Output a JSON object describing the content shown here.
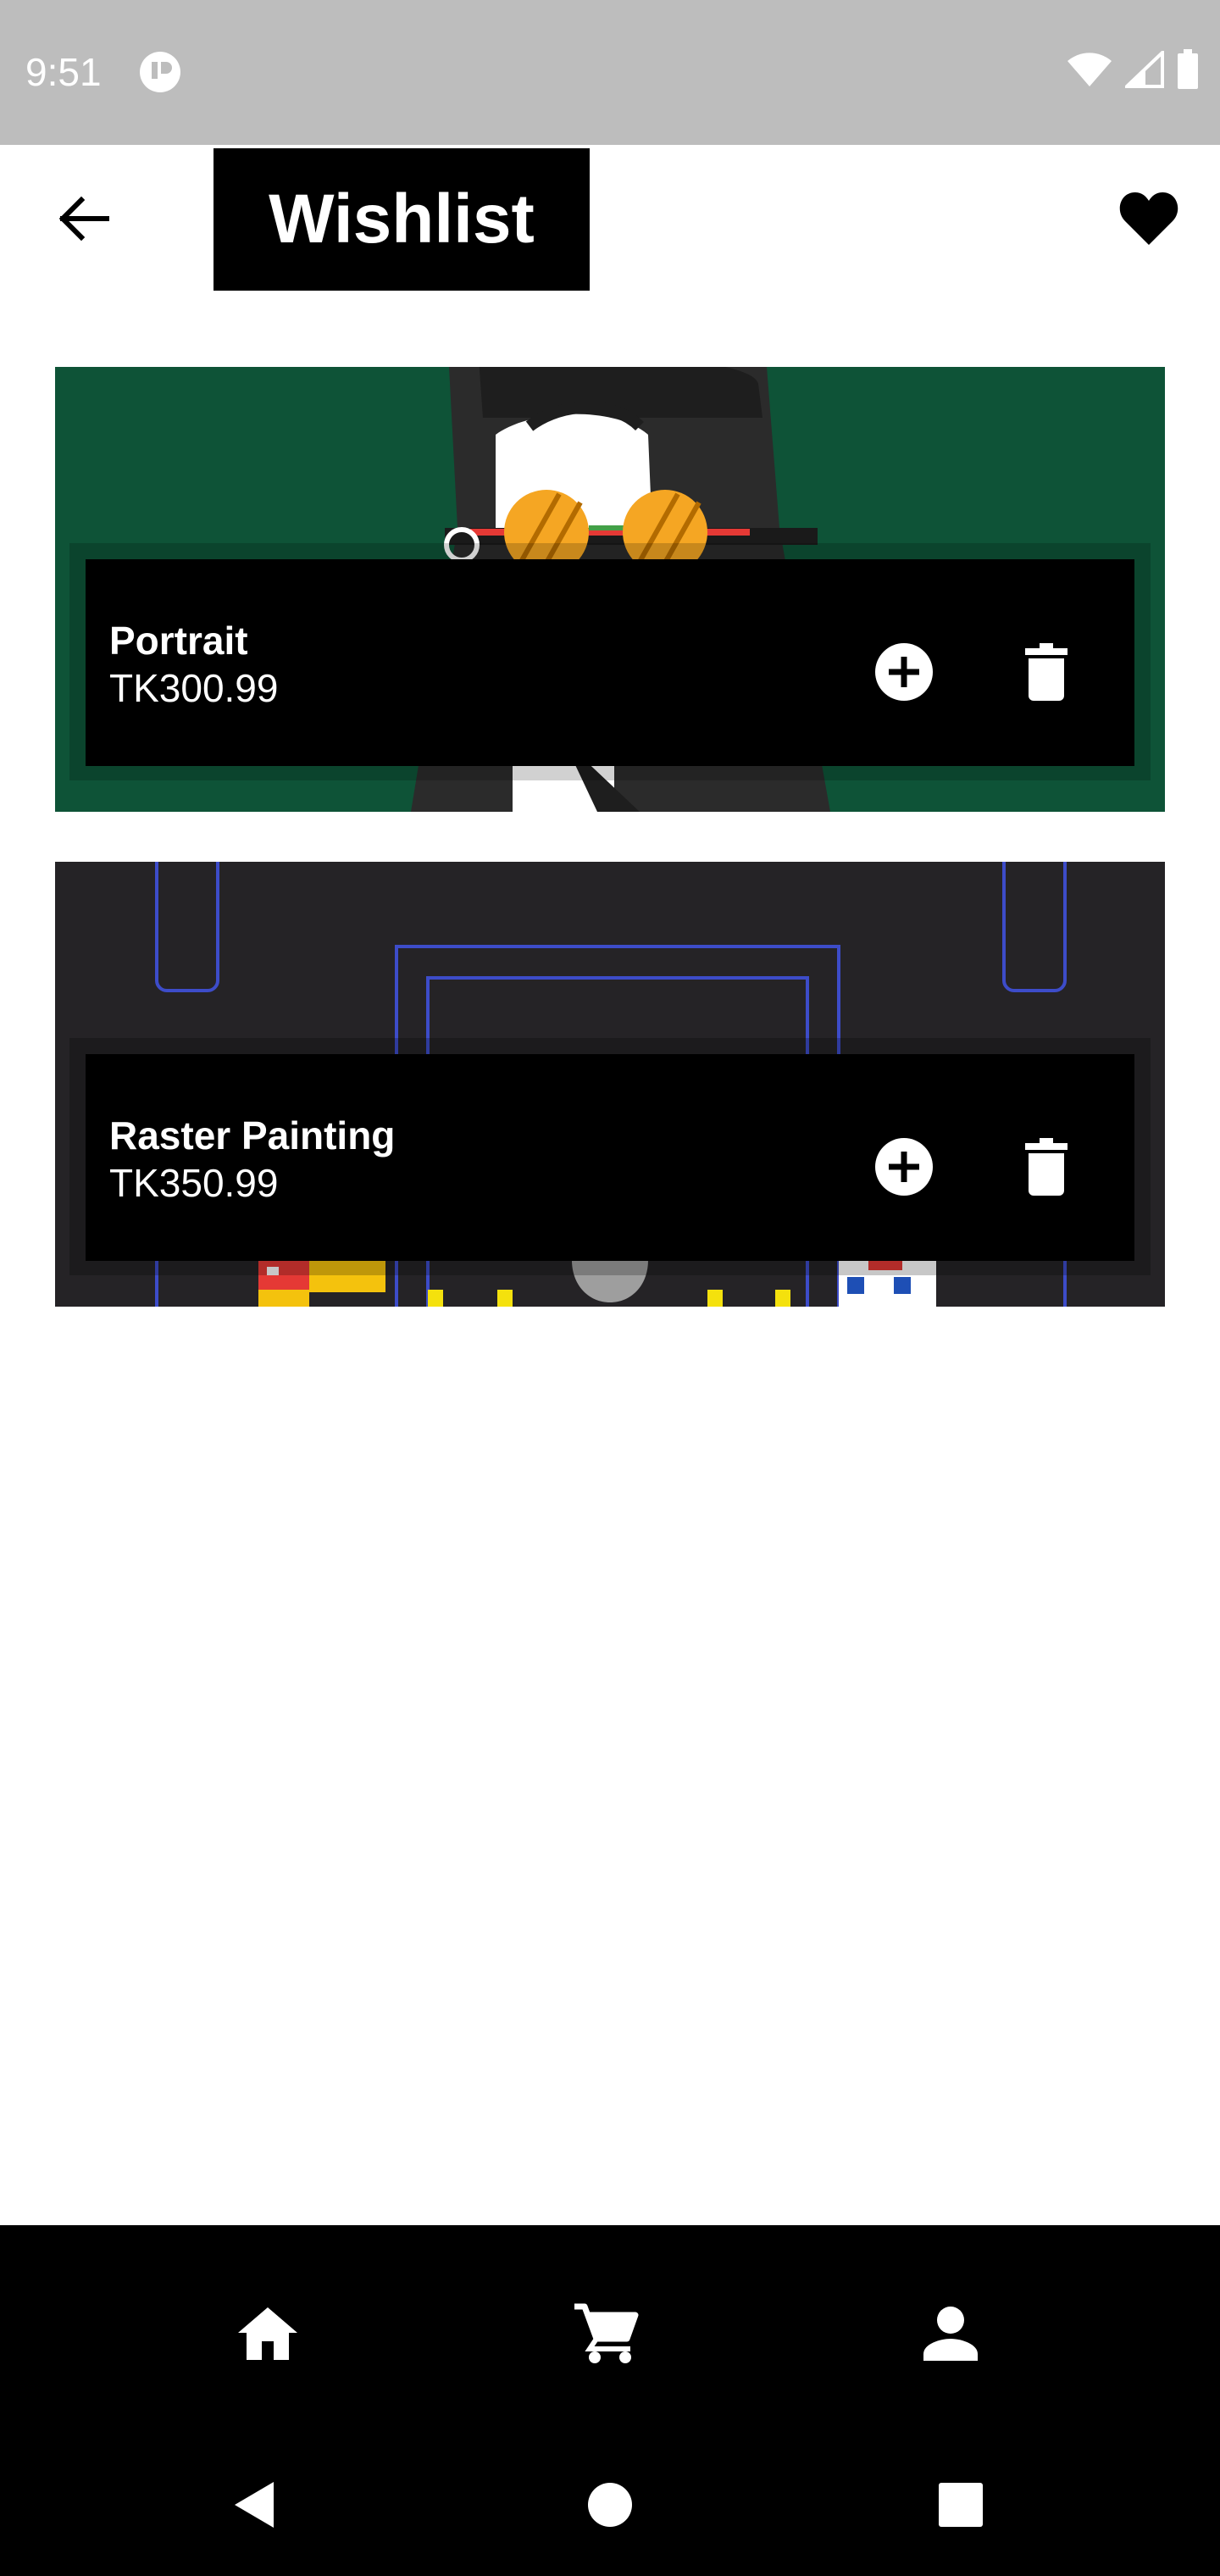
{
  "status_bar": {
    "time": "9:51"
  },
  "header": {
    "title": "Wishlist",
    "back_icon": "arrow-back-icon",
    "favorite_icon": "heart-icon"
  },
  "wishlist": {
    "items": [
      {
        "name": "Portrait",
        "price": "TK300.99",
        "add_icon": "add-circle-icon",
        "delete_icon": "trash-icon"
      },
      {
        "name": "Raster Painting",
        "price": "TK350.99",
        "add_icon": "add-circle-icon",
        "delete_icon": "trash-icon"
      }
    ]
  },
  "bottom_nav": {
    "items": [
      "home-icon",
      "cart-icon",
      "person-icon"
    ]
  },
  "system_nav": {
    "items": [
      "back-triangle-icon",
      "home-circle-icon",
      "recents-square-icon"
    ]
  },
  "colors": {
    "accent": "#000000",
    "status_bar": "#bdbdbd",
    "card_1_background": "#0e5337",
    "card_2_background": "#252326",
    "background": "#ffffff"
  }
}
